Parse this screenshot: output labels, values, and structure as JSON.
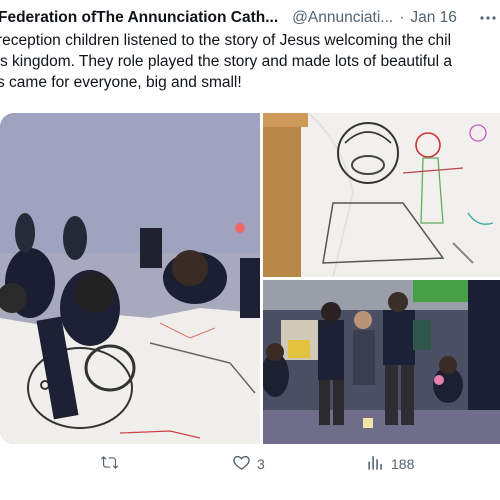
{
  "tweet": {
    "author_name": "Federation ofThe Annunciation Cath...",
    "author_handle": "@Annunciati...",
    "separator": "·",
    "date": "Jan 16",
    "text_lines": [
      "reception children listened to the story of Jesus welcoming the chil",
      "'s kingdom. They role played the story and made lots of beautiful a",
      "s came for everyone, big and small!"
    ]
  },
  "actions": {
    "retweets": "",
    "likes": "3",
    "views": "188"
  },
  "icons": {
    "more": "more-dots-icon",
    "retweet": "retweet-icon",
    "like": "heart-icon",
    "views": "views-chart-icon"
  },
  "colors": {
    "text_primary": "#0f1419",
    "text_secondary": "#536471",
    "paper_drawing": "#f2f1ee"
  }
}
